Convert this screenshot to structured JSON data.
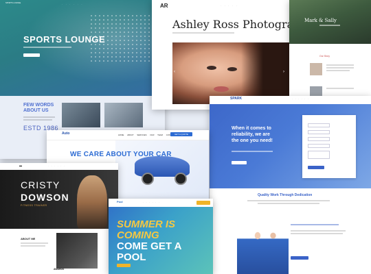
{
  "sports": {
    "brand": "SPORTS LOUNGE",
    "title": "SPORTS LOUNGE",
    "few_words_1": "FEW WORDS",
    "few_words_2": "ABOUT US",
    "estd": "ESTD 1986"
  },
  "photo": {
    "logo": "AR",
    "title": "Ashley Ross Photography",
    "arrow_left": "‹",
    "arrow_right": "›"
  },
  "wedding": {
    "names": "Mark & Sally",
    "story": "Our Story"
  },
  "spark": {
    "logo": "SPARK",
    "headline_1": "When it comes to",
    "headline_2": "reliability, we are",
    "headline_3": "the one you need!",
    "quality": "Quality Work Through Dedication"
  },
  "auto": {
    "logo": "Auto",
    "headline": "WE CARE ABOUT YOUR CAR",
    "nav": "HOME  ABOUT  SERVICES  OUR TEAM  CONTACT",
    "cta": "GET A QUOTE"
  },
  "cristy": {
    "name_1": "CRISTY",
    "name_2": "DOWSON",
    "role": "FITNESS TRAINER",
    "about": "ABOUT ME",
    "awards": "AWARDS"
  },
  "pool": {
    "logo": "Pool",
    "t1": "SUMMER IS",
    "t2": "COMING",
    "t3": "COME GET A",
    "t4": "POOL"
  }
}
